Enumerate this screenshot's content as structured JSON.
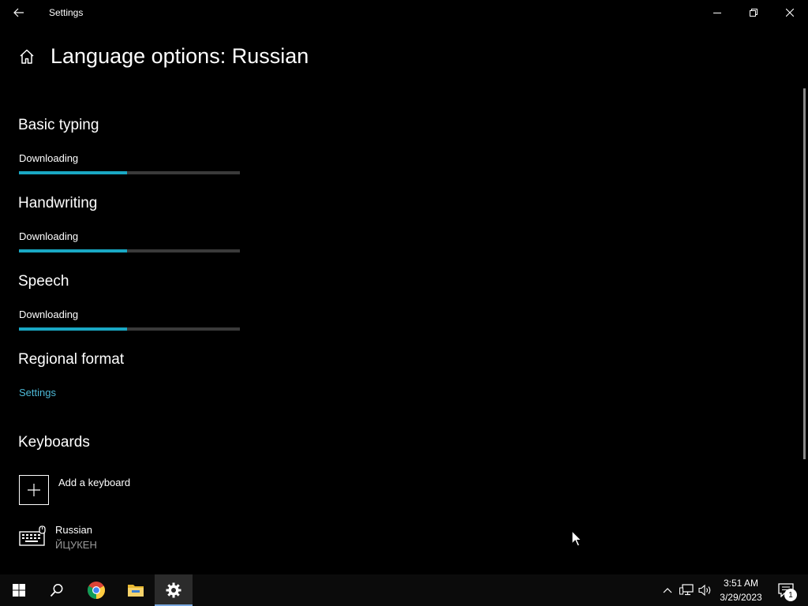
{
  "window": {
    "title": "Settings",
    "back_icon": "back-arrow-icon",
    "controls": [
      "minimize-icon",
      "restore-icon",
      "close-icon"
    ]
  },
  "page": {
    "title": "Language options: Russian",
    "home_icon": "home-icon"
  },
  "sections": {
    "basic_typing": {
      "heading": "Basic typing",
      "status": "Downloading",
      "progress": 0.49
    },
    "handwriting": {
      "heading": "Handwriting",
      "status": "Downloading",
      "progress": 0.49
    },
    "speech": {
      "heading": "Speech",
      "status": "Downloading",
      "progress": 0.49
    },
    "regional_format": {
      "heading": "Regional format",
      "link": "Settings"
    },
    "keyboards": {
      "heading": "Keyboards",
      "add_label": "Add a keyboard",
      "items": [
        {
          "name": "Russian",
          "layout": "ЙЦУКЕН",
          "icon": "keyboard-icon"
        }
      ]
    }
  },
  "taskbar": {
    "apps": [
      "windows-start-icon",
      "search-icon",
      "chrome-icon",
      "file-explorer-icon",
      "settings-gear-icon"
    ],
    "tray_icons": [
      "chevron-up-icon",
      "network-icon",
      "volume-icon"
    ],
    "time": "3:51 AM",
    "date": "3/29/2023",
    "notifications_count": "1"
  },
  "colors": {
    "background": "#000000",
    "accent": "#1aa8c4",
    "link": "#4db8d6",
    "track": "#3a3a3a"
  }
}
